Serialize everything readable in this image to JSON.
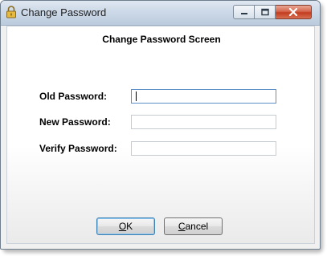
{
  "window": {
    "title": "Change Password"
  },
  "form": {
    "heading": "Change Password Screen",
    "fields": [
      {
        "label": "Old Password:",
        "value": ""
      },
      {
        "label": "New Password:",
        "value": ""
      },
      {
        "label": "Verify Password:",
        "value": ""
      }
    ]
  },
  "buttons": {
    "ok_mnemonic": "O",
    "ok_rest": "K",
    "cancel_mnemonic": "C",
    "cancel_rest": "ancel"
  },
  "icons": {
    "app": "lock-icon",
    "minimize": "minimize-icon",
    "maximize": "maximize-icon",
    "close": "close-icon"
  },
  "colors": {
    "titlebar": "#cbd8e7",
    "close_button": "#c23d1f",
    "focus_border": "#5b8fc6"
  }
}
